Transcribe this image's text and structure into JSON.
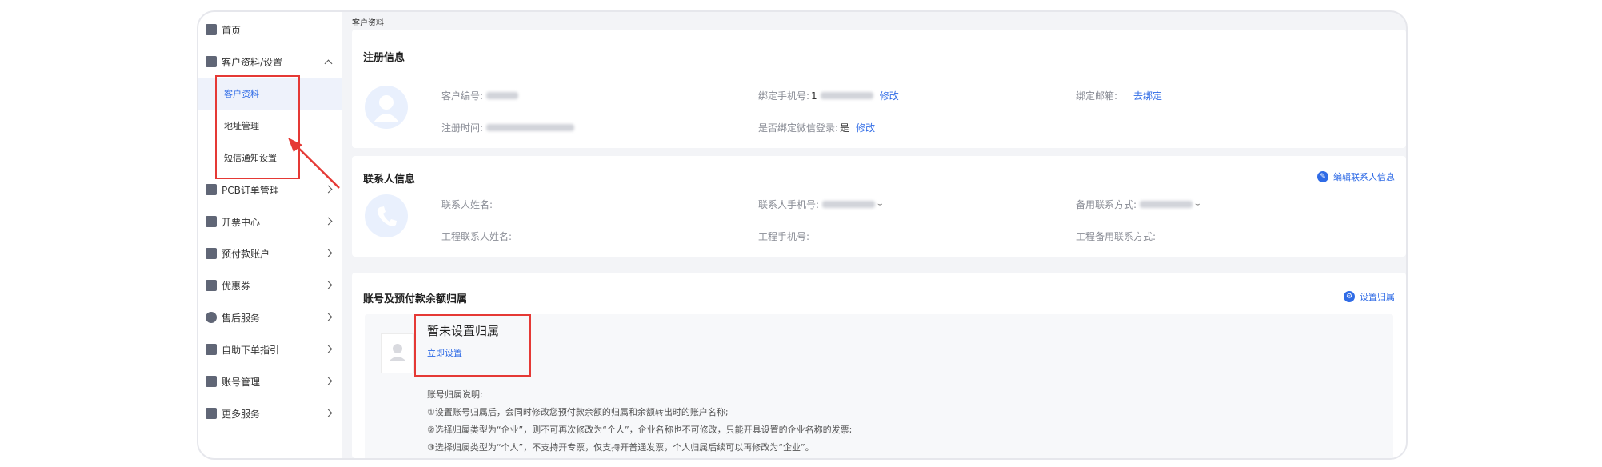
{
  "sidebar": {
    "items": [
      {
        "label": "首页",
        "icon": "home-icon"
      },
      {
        "label": "客户资料/设置",
        "icon": "user-profile-icon",
        "expanded": true
      },
      {
        "label": "PCB订单管理",
        "icon": "order-icon"
      },
      {
        "label": "开票中心",
        "icon": "invoice-icon"
      },
      {
        "label": "预付款账户",
        "icon": "wallet-icon"
      },
      {
        "label": "优惠券",
        "icon": "coupon-icon"
      },
      {
        "label": "售后服务",
        "icon": "after-sales-icon"
      },
      {
        "label": "自助下单指引",
        "icon": "guide-icon"
      },
      {
        "label": "账号管理",
        "icon": "account-icon"
      },
      {
        "label": "更多服务",
        "icon": "more-icon"
      }
    ],
    "sub_items": [
      {
        "label": "客户资料",
        "active": true
      },
      {
        "label": "地址管理"
      },
      {
        "label": "短信通知设置"
      }
    ]
  },
  "breadcrumb": "客户资料",
  "registration": {
    "title": "注册信息",
    "customer_id_label": "客户编号:",
    "phone_label": "绑定手机号:",
    "phone_prefix": "1",
    "phone_edit": "修改",
    "email_label": "绑定邮箱:",
    "email_bind": "去绑定",
    "reg_time_label": "注册时间:",
    "wechat_label": "是否绑定微信登录:",
    "wechat_value": "是",
    "wechat_edit": "修改"
  },
  "contact": {
    "title": "联系人信息",
    "edit_action": "编辑联系人信息",
    "name_label": "联系人姓名:",
    "phone_label": "联系人手机号:",
    "backup_label": "备用联系方式:",
    "eng_name_label": "工程联系人姓名:",
    "eng_phone_label": "工程手机号:",
    "eng_backup_label": "工程备用联系方式:"
  },
  "ownership": {
    "title": "账号及预付款余额归属",
    "set_action": "设置归属",
    "status": "暂未设置归属",
    "set_now": "立即设置",
    "notes_title": "账号归属说明:",
    "notes": [
      "①设置账号归属后，会同时修改您预付款余额的归属和余额转出时的账户名称;",
      "②选择归属类型为“企业”，则不可再次修改为“个人”，企业名称也不可修改，只能开具设置的企业名称的发票;",
      "③选择归属类型为“个人”，不支持开专票，仅支持开普通发票，个人归属后续可以再修改为“企业”。"
    ]
  },
  "colors": {
    "accent": "#2f6be6",
    "highlight": "#e53935",
    "background": "#f3f4f7"
  }
}
